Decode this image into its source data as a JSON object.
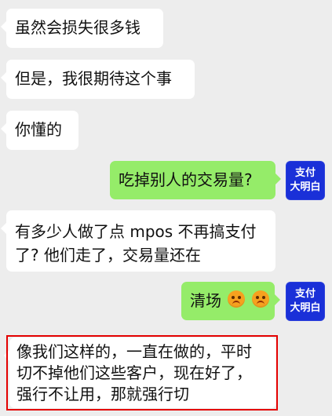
{
  "chat": {
    "messages": [
      {
        "sender": "other",
        "text": "虽然会损失很多钱"
      },
      {
        "sender": "other",
        "text": "但是，我很期待这个事"
      },
      {
        "sender": "other",
        "text": "你懂的"
      },
      {
        "sender": "self",
        "text": "吃掉别人的交易量?"
      },
      {
        "sender": "other",
        "line1": "有多少人做了点 mpos 不再搞支付",
        "line2": "了? 他们走了，交易量还在"
      },
      {
        "sender": "self",
        "text": "清场",
        "emoji_1": "angry-face-icon",
        "emoji_2": "angry-face-icon"
      },
      {
        "sender": "other",
        "line1": "像我们这样的，一直在做的，平时",
        "line2": "切不掉他们这些客户，现在好了，",
        "line3": "强行不让用，那就强行切",
        "highlight_color": "#e40000"
      }
    ]
  },
  "avatars": {
    "self": {
      "line1": "支付",
      "line2": "大明白",
      "background": "#1a30d8",
      "text_color": "#ffffff"
    }
  },
  "colors": {
    "background": "#ededed",
    "incoming_bubble": "#ffffff",
    "outgoing_bubble": "#95ec69",
    "highlight": "#e40000"
  }
}
